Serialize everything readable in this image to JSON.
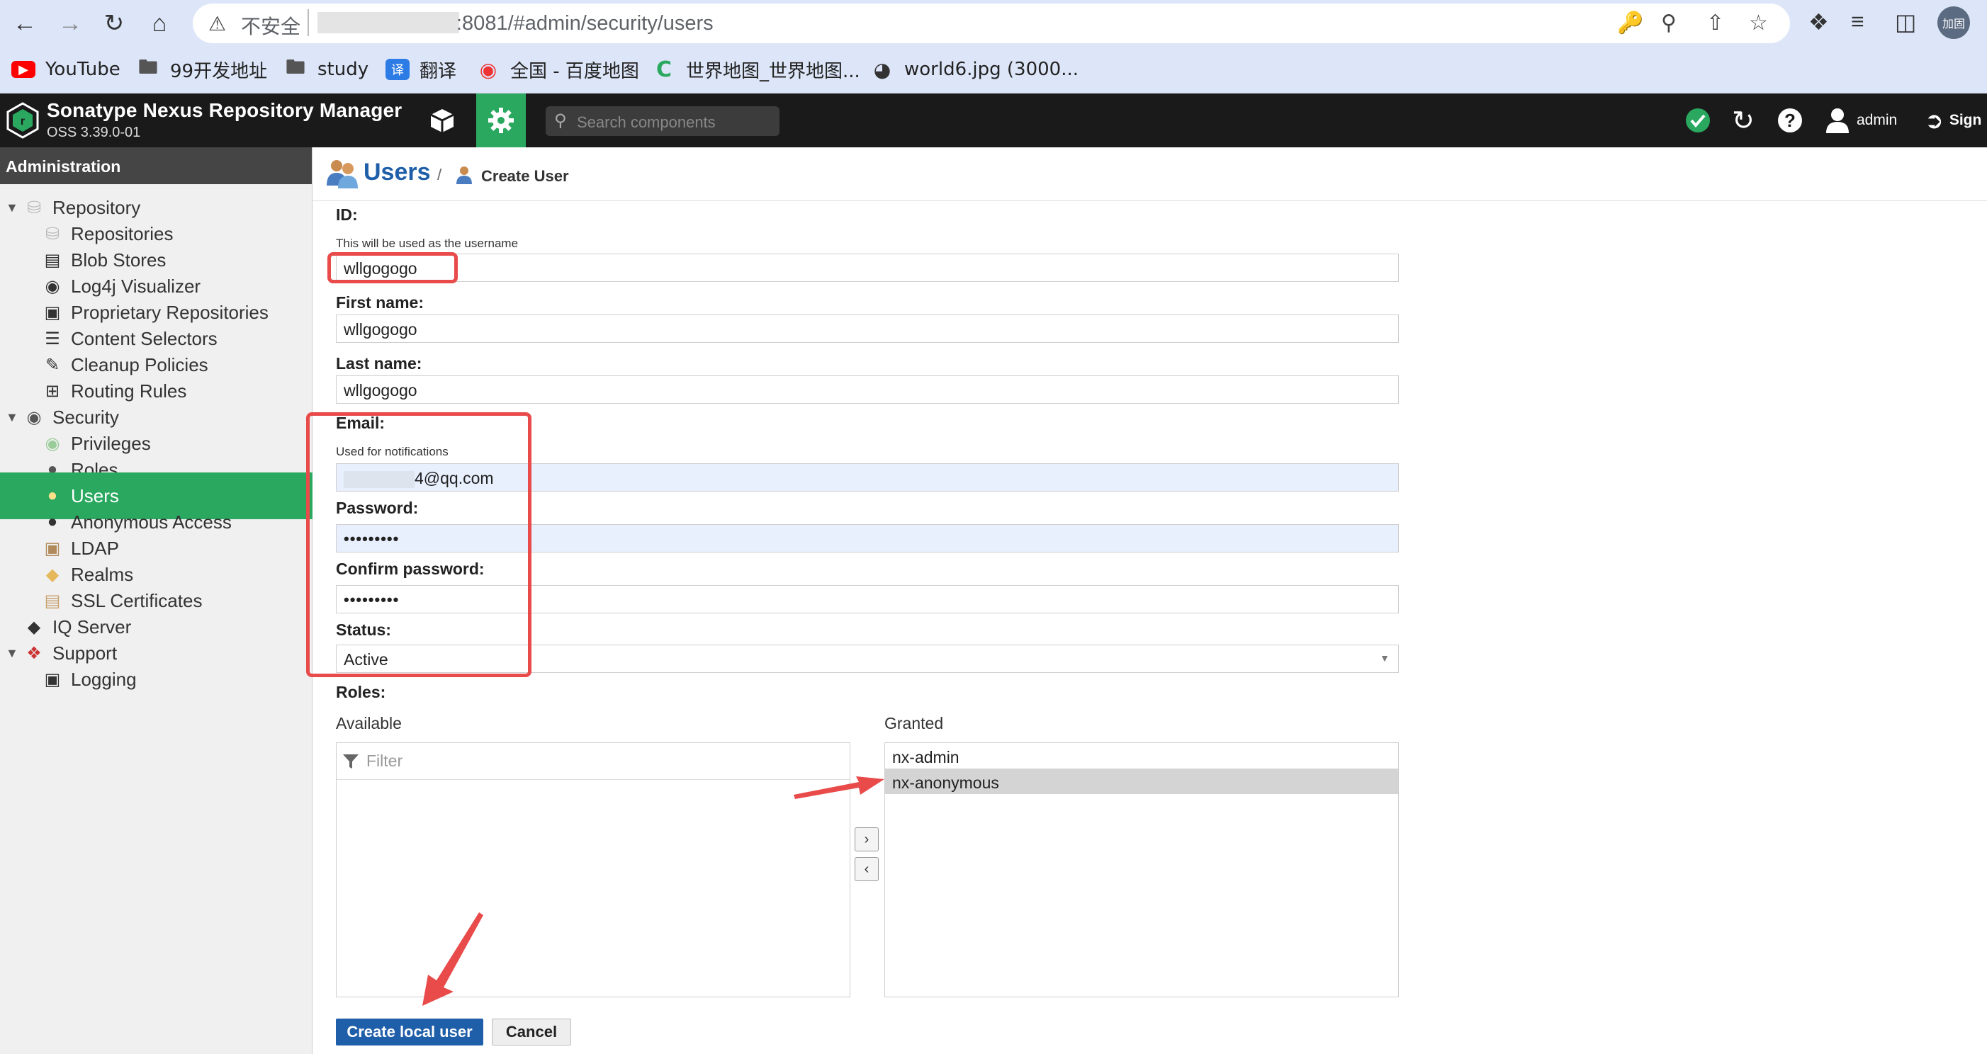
{
  "browser": {
    "insecure_label": "不安全",
    "url": ":8081/#admin/security/users",
    "profile_label": "加固",
    "bookmarks": [
      {
        "label": "YouTube",
        "icon": "youtube-icon",
        "color": "#ff0000"
      },
      {
        "label": "99开发地址",
        "icon": "folder-icon"
      },
      {
        "label": "study",
        "icon": "folder-icon"
      },
      {
        "label": "翻译",
        "icon": "translate-icon",
        "color": "#2d7be5"
      },
      {
        "label": "全国 - 百度地图",
        "icon": "map-pin-icon",
        "color": "#e33"
      },
      {
        "label": "世界地图_世界地图...",
        "icon": "globe-c-icon",
        "color": "#2aa85f"
      },
      {
        "label": "world6.jpg (3000...",
        "icon": "globe-icon",
        "color": "#333"
      }
    ]
  },
  "header": {
    "app_title": "Sonatype Nexus Repository Manager",
    "version": "OSS 3.39.0-01",
    "search_placeholder": "Search components",
    "user": "admin",
    "sign_label": "Sign",
    "accent": "#2aa85f"
  },
  "sidebar": {
    "title": "Administration",
    "items": [
      {
        "label": "Repository",
        "type": "group",
        "icon": "database-icon"
      },
      {
        "label": "Repositories",
        "type": "child",
        "icon": "database-icon"
      },
      {
        "label": "Blob Stores",
        "type": "child",
        "icon": "server-icon"
      },
      {
        "label": "Log4j Visualizer",
        "type": "child",
        "icon": "binoculars-icon"
      },
      {
        "label": "Proprietary Repositories",
        "type": "child",
        "icon": "book-icon"
      },
      {
        "label": "Content Selectors",
        "type": "child",
        "icon": "layers-icon"
      },
      {
        "label": "Cleanup Policies",
        "type": "child",
        "icon": "brush-icon"
      },
      {
        "label": "Routing Rules",
        "type": "child",
        "icon": "signpost-icon"
      },
      {
        "label": "Security",
        "type": "group",
        "icon": "eye-icon"
      },
      {
        "label": "Privileges",
        "type": "child",
        "icon": "medal-icon"
      },
      {
        "label": "Roles",
        "type": "child",
        "icon": "user-role-icon"
      },
      {
        "label": "Users",
        "type": "child",
        "icon": "users-icon",
        "active": true
      },
      {
        "label": "Anonymous Access",
        "type": "child",
        "icon": "user-icon"
      },
      {
        "label": "LDAP",
        "type": "child",
        "icon": "address-book-icon"
      },
      {
        "label": "Realms",
        "type": "child",
        "icon": "shield-icon"
      },
      {
        "label": "SSL Certificates",
        "type": "child",
        "icon": "certificate-icon"
      },
      {
        "label": "IQ Server",
        "type": "group-noarrow",
        "icon": "iq-shield-icon"
      },
      {
        "label": "Support",
        "type": "group",
        "icon": "lifebuoy-icon"
      },
      {
        "label": "Logging",
        "type": "child",
        "icon": "book-icon"
      }
    ]
  },
  "breadcrumb": {
    "title": "Users",
    "separator": "/",
    "current": "Create User"
  },
  "form": {
    "id_label": "ID:",
    "id_help": "This will be used as the username",
    "id_value": "wllgogogo",
    "first_name_label": "First name:",
    "first_name_value": "wllgogogo",
    "last_name_label": "Last name:",
    "last_name_value": "wllgogogo",
    "email_label": "Email:",
    "email_help": "Used for notifications",
    "email_value": "4@qq.com",
    "password_label": "Password:",
    "password_value": "•••••••••",
    "confirm_label": "Confirm password:",
    "confirm_value": "•••••••••",
    "status_label": "Status:",
    "status_value": "Active",
    "roles_label": "Roles:",
    "available_label": "Available",
    "filter_placeholder": "Filter",
    "granted_label": "Granted",
    "granted": [
      "nx-admin",
      "nx-anonymous"
    ],
    "create_label": "Create local user",
    "cancel_label": "Cancel"
  },
  "annotation_color": "#e94a4a"
}
